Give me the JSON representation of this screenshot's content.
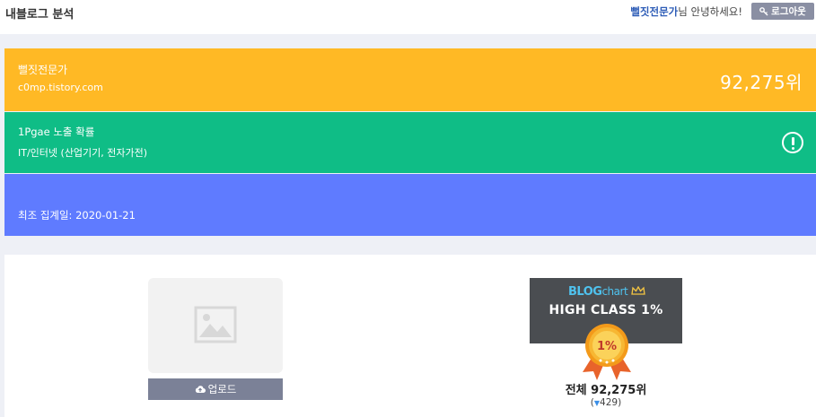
{
  "header": {
    "title": "내블로그 분석",
    "username": "뻘짓전문가",
    "greeting_suffix": "님 안녕하세요!",
    "logout_label": "로그아웃"
  },
  "blog": {
    "name": "뻘짓전문가",
    "url": "c0mp.tistory.com",
    "rank": "92,275위"
  },
  "exposure": {
    "label": "1Pgae 노출 확률",
    "category": "IT/인터넷 (산업기기, 전자가전)"
  },
  "aggregation": {
    "last_date": "최조 집계일: 2020-01-21"
  },
  "profile": {
    "upload_label": "업로드"
  },
  "blogchart": {
    "logo_part1": "BLOG",
    "logo_part2": "chart",
    "class_label": "HIGH CLASS 1%",
    "medal_label": "1%",
    "total_rank": "전체 92,275위",
    "rank_change": "429"
  },
  "colors": {
    "yellow_panel": "#ffb925",
    "green_panel": "#0fbd86",
    "blue_panel": "#5f7bff",
    "link_blue": "#2e5db7"
  }
}
